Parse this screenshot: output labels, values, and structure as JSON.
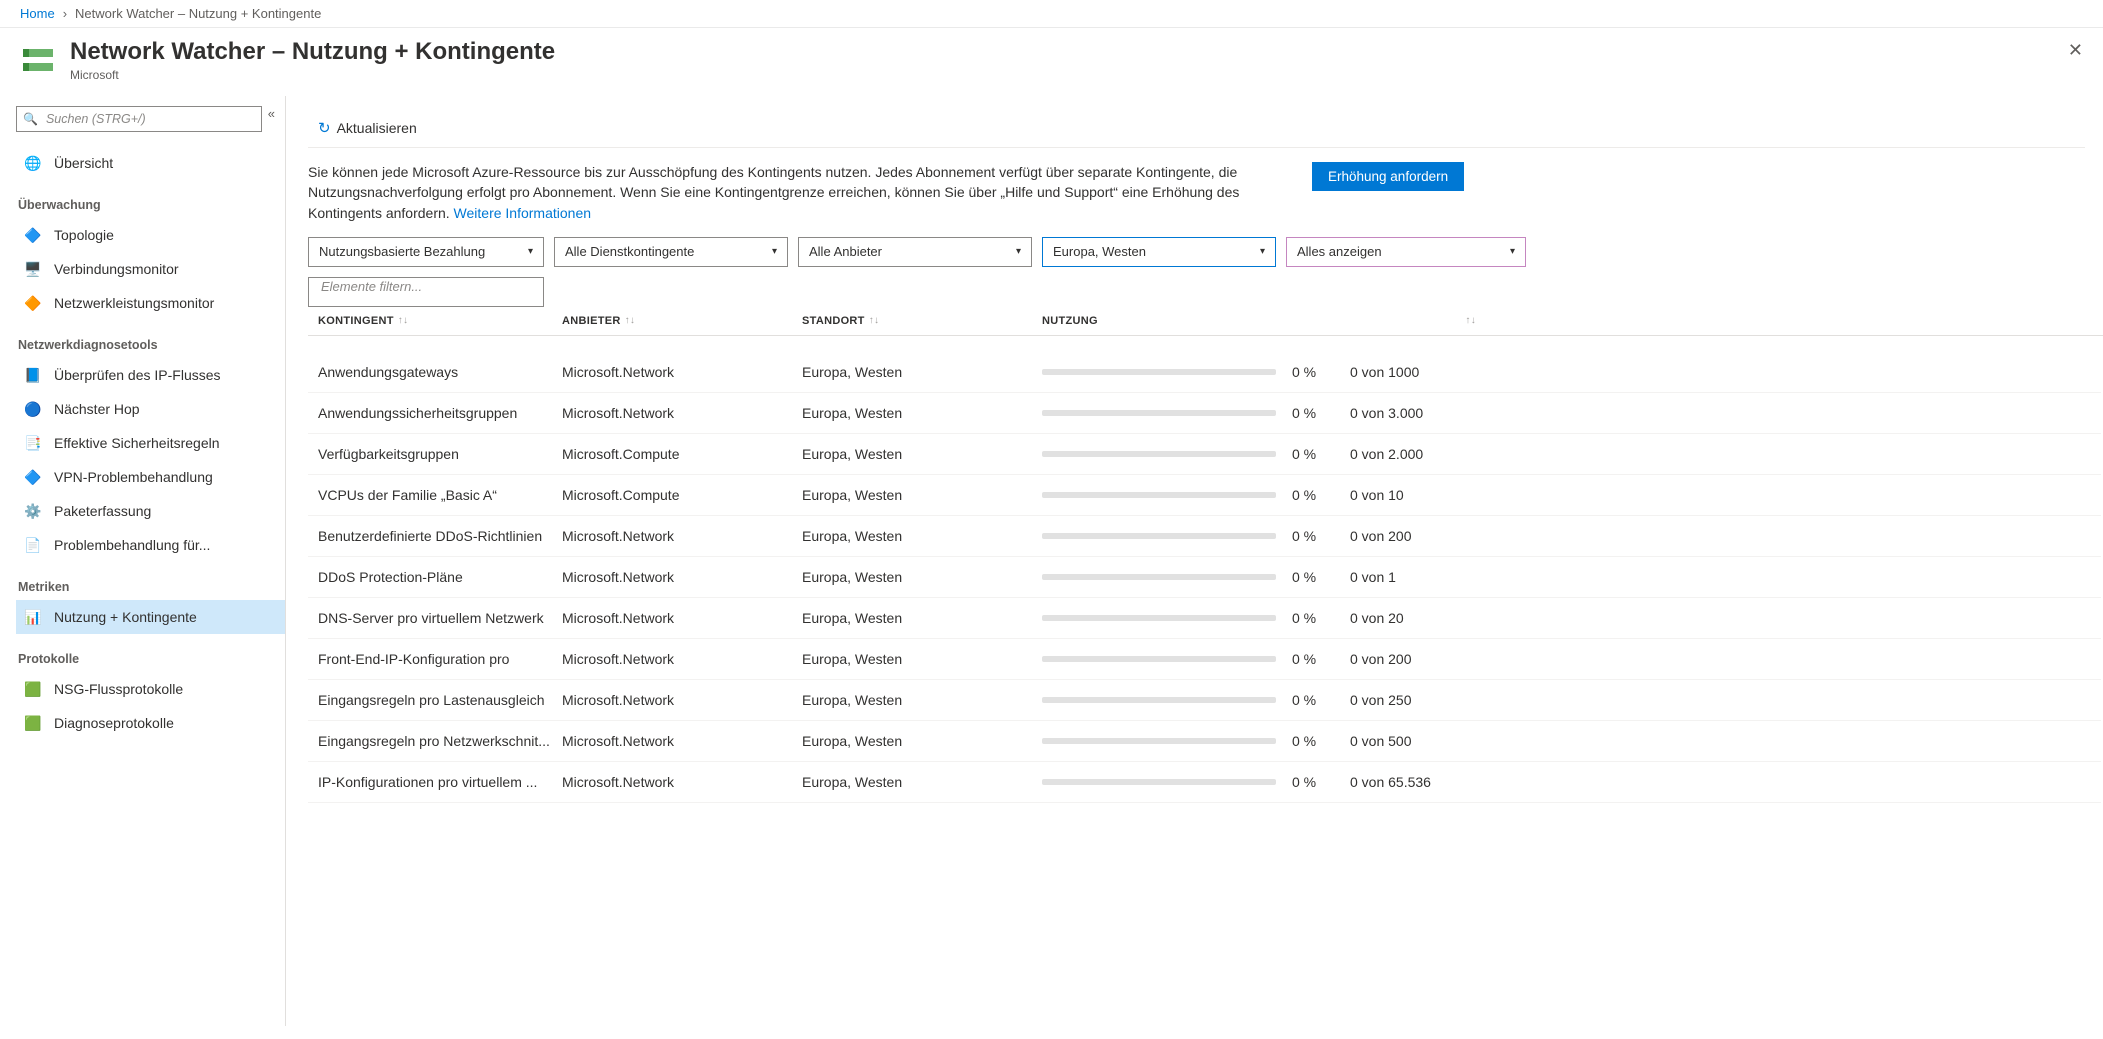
{
  "breadcrumb": {
    "home": "Home",
    "current": "Network Watcher – Nutzung + Kontingente"
  },
  "header": {
    "title": "Network Watcher – Nutzung + Kontingente",
    "subtitle": "Microsoft",
    "close_aria": "Schließen"
  },
  "sidebar": {
    "search_placeholder": "Suchen (STRG+/)",
    "items": [
      {
        "label": "Übersicht",
        "icon": "🌐"
      }
    ],
    "sections": [
      {
        "title": "Überwachung",
        "items": [
          {
            "label": "Topologie",
            "icon": "🔷"
          },
          {
            "label": "Verbindungsmonitor",
            "icon": "🖥️"
          },
          {
            "label": "Netzwerkleistungsmonitor",
            "icon": "🔶"
          }
        ]
      },
      {
        "title": "Netzwerkdiagnosetools",
        "items": [
          {
            "label": "Überprüfen des IP-Flusses",
            "icon": "📘"
          },
          {
            "label": "Nächster Hop",
            "icon": "🔵"
          },
          {
            "label": "Effektive Sicherheitsregeln",
            "icon": "📑"
          },
          {
            "label": "VPN-Problembehandlung",
            "icon": "🔷"
          },
          {
            "label": "Paketerfassung",
            "icon": "⚙️"
          },
          {
            "label": "Problembehandlung für...",
            "icon": "📄"
          }
        ]
      },
      {
        "title": "Metriken",
        "items": [
          {
            "label": "Nutzung + Kontingente",
            "icon": "📊",
            "selected": true
          }
        ]
      },
      {
        "title": "Protokolle",
        "items": [
          {
            "label": "NSG-Flussprotokolle",
            "icon": "🟩"
          },
          {
            "label": "Diagnoseprotokolle",
            "icon": "🟩"
          }
        ]
      }
    ]
  },
  "commands": {
    "refresh": "Aktualisieren"
  },
  "info": {
    "text": "Sie können jede Microsoft Azure-Ressource bis zur Ausschöpfung des Kontingents nutzen. Jedes Abonnement verfügt über separate Kontingente, die Nutzungsnachverfolgung erfolgt pro Abonnement. Wenn Sie eine Kontingentgrenze erreichen, können Sie über „Hilfe und Support“ eine Erhöhung des Kontingents anfordern. ",
    "link": "Weitere Informationen",
    "request_button": "Erhöhung anfordern"
  },
  "filters": {
    "subscription": "Nutzungsbasierte Bezahlung",
    "quota": "Alle Dienstkontingente",
    "provider": "Alle Anbieter",
    "location": "Europa, Westen",
    "show": "Alles anzeigen",
    "items_placeholder": "Elemente filtern..."
  },
  "table": {
    "headers": {
      "quota": "Kontingent",
      "provider": "Anbieter",
      "location": "Standort",
      "usage": "Nutzung"
    },
    "rows": [
      {
        "quota": "Anwendungsgateways",
        "provider": "Microsoft.Network",
        "location": "Europa, Westen",
        "percent": "0 %",
        "limit": "0 von 1000"
      },
      {
        "quota": "Anwendungssicherheitsgruppen",
        "provider": "Microsoft.Network",
        "location": "Europa, Westen",
        "percent": "0 %",
        "limit": "0 von 3.000"
      },
      {
        "quota": "Verfügbarkeitsgruppen",
        "provider": "Microsoft.Compute",
        "location": "Europa, Westen",
        "percent": "0 %",
        "limit": "0 von 2.000"
      },
      {
        "quota": "VCPUs der Familie „Basic A“",
        "provider": "Microsoft.Compute",
        "location": "Europa, Westen",
        "percent": "0 %",
        "limit": "0 von 10"
      },
      {
        "quota": "Benutzerdefinierte DDoS-Richtlinien",
        "provider": "Microsoft.Network",
        "location": "Europa, Westen",
        "percent": "0 %",
        "limit": "0 von 200"
      },
      {
        "quota": "DDoS Protection-Pläne",
        "provider": "Microsoft.Network",
        "location": "Europa, Westen",
        "percent": "0 %",
        "limit": "0 von 1"
      },
      {
        "quota": "DNS-Server pro virtuellem Netzwerk",
        "provider": "Microsoft.Network",
        "location": "Europa, Westen",
        "percent": "0 %",
        "limit": "0 von 20"
      },
      {
        "quota": "Front-End-IP-Konfiguration pro",
        "provider": "Microsoft.Network",
        "location": "Europa, Westen",
        "percent": "0 %",
        "limit": "0 von 200"
      },
      {
        "quota": "Eingangsregeln pro Lastenausgleich",
        "provider": "Microsoft.Network",
        "location": "Europa, Westen",
        "percent": "0 %",
        "limit": "0 von 250"
      },
      {
        "quota": "Eingangsregeln pro Netzwerkschnit...",
        "provider": "Microsoft.Network",
        "location": "Europa, Westen",
        "percent": "0 %",
        "limit": "0 von 500"
      },
      {
        "quota": "IP-Konfigurationen pro virtuellem ...",
        "provider": "Microsoft.Network",
        "location": "Europa, Westen",
        "percent": "0 %",
        "limit": "0 von 65.536"
      }
    ]
  }
}
